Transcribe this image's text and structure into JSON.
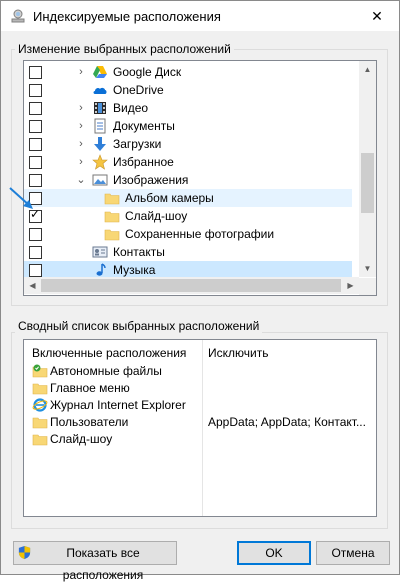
{
  "window": {
    "title": "Индексируемые расположения",
    "close_glyph": "✕"
  },
  "locations": {
    "group_label": "Изменение выбранных расположений",
    "items": [
      {
        "label": "Google Диск",
        "icon": "google-drive-icon",
        "checked": false,
        "expander": "›",
        "indent": 1
      },
      {
        "label": "OneDrive",
        "icon": "onedrive-icon",
        "checked": false,
        "expander": "",
        "indent": 1
      },
      {
        "label": "Видео",
        "icon": "video-folder-icon",
        "checked": false,
        "expander": "›",
        "indent": 1
      },
      {
        "label": "Документы",
        "icon": "documents-folder-icon",
        "checked": false,
        "expander": "›",
        "indent": 1
      },
      {
        "label": "Загрузки",
        "icon": "downloads-folder-icon",
        "checked": false,
        "expander": "›",
        "indent": 1
      },
      {
        "label": "Избранное",
        "icon": "favorites-star-icon",
        "checked": false,
        "expander": "›",
        "indent": 1
      },
      {
        "label": "Изображения",
        "icon": "pictures-folder-icon",
        "checked": false,
        "expander": "⌄",
        "indent": 1
      },
      {
        "label": "Альбом камеры",
        "icon": "folder-icon",
        "checked": false,
        "expander": "",
        "indent": 2
      },
      {
        "label": "Слайд-шоу",
        "icon": "folder-icon",
        "checked": true,
        "expander": "",
        "indent": 2
      },
      {
        "label": "Сохраненные фотографии",
        "icon": "folder-icon",
        "checked": false,
        "expander": "",
        "indent": 2
      },
      {
        "label": "Контакты",
        "icon": "contacts-folder-icon",
        "checked": false,
        "expander": "",
        "indent": 1
      },
      {
        "label": "Музыка",
        "icon": "music-folder-icon",
        "checked": false,
        "expander": "",
        "indent": 1
      }
    ]
  },
  "summary": {
    "group_label": "Сводный список выбранных расположений",
    "col_included": "Включенные расположения",
    "col_exclude": "Исключить",
    "rows": [
      {
        "label": "Автономные файлы",
        "icon": "offline-files-icon",
        "exclude": ""
      },
      {
        "label": "Главное меню",
        "icon": "folder-icon",
        "exclude": ""
      },
      {
        "label": "Журнал Internet Explorer",
        "icon": "internet-explorer-icon",
        "exclude": ""
      },
      {
        "label": "Пользователи",
        "icon": "folder-icon",
        "exclude": "AppData; AppData; Контакт..."
      },
      {
        "label": "Слайд-шоу",
        "icon": "folder-icon",
        "exclude": ""
      }
    ]
  },
  "buttons": {
    "show_all": "Показать все расположения",
    "ok": "OK",
    "cancel": "Отмена"
  },
  "colors": {
    "selection": "#cce8ff",
    "hover": "#e5f3ff",
    "folder": "#f8d775",
    "accent": "#0078d7"
  }
}
